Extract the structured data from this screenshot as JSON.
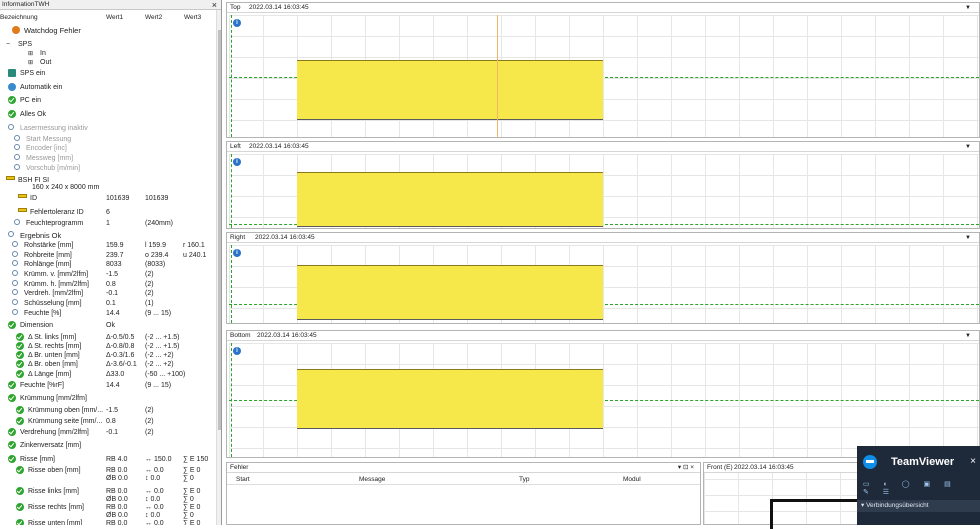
{
  "left_panel": {
    "title": "InformationTWH",
    "close": "×",
    "columns": [
      "Bezeichnung",
      "Wert1",
      "Wert2",
      "Wert3"
    ],
    "rows": [
      {
        "label": "Watchdog Fehler",
        "w1": "",
        "w2": "",
        "w3": ""
      },
      {
        "label": "SPS",
        "w1": "",
        "w2": "",
        "w3": ""
      },
      {
        "label": "In",
        "w1": "",
        "w2": "",
        "w3": ""
      },
      {
        "label": "Out",
        "w1": "",
        "w2": "",
        "w3": ""
      },
      {
        "label": "SPS ein",
        "w1": "",
        "w2": "",
        "w3": ""
      },
      {
        "label": "Automatik ein",
        "w1": "",
        "w2": "",
        "w3": ""
      },
      {
        "label": "PC ein",
        "w1": "",
        "w2": "",
        "w3": ""
      },
      {
        "label": "Alles Ok",
        "w1": "",
        "w2": "",
        "w3": ""
      },
      {
        "label": "Lasermessung inaktiv",
        "w1": "",
        "w2": "",
        "w3": ""
      },
      {
        "label": "Start Messung",
        "w1": "",
        "w2": "",
        "w3": ""
      },
      {
        "label": "Encoder [inc]",
        "w1": "",
        "w2": "",
        "w3": ""
      },
      {
        "label": "Messweg [mm]",
        "w1": "",
        "w2": "",
        "w3": ""
      },
      {
        "label": "Vorschub [m/min]",
        "w1": "",
        "w2": "",
        "w3": ""
      },
      {
        "label": "BSH   FI   SI",
        "w1": "",
        "w2": "",
        "w3": ""
      },
      {
        "label": "160 x 240 x 8000 mm",
        "w1": "",
        "w2": "",
        "w3": ""
      },
      {
        "label": "ID",
        "w1": "101639",
        "w2": "101639",
        "w3": ""
      },
      {
        "label": "Fehlertoleranz ID",
        "w1": "6",
        "w2": "",
        "w3": ""
      },
      {
        "label": "Feuchteprogramm",
        "w1": "1",
        "w2": "(240mm)",
        "w3": ""
      },
      {
        "label": "Ergebnis Ok",
        "w1": "",
        "w2": "",
        "w3": ""
      },
      {
        "label": "Rohstärke [mm]",
        "w1": "159.9",
        "w2": "l 159.9",
        "w3": "r 160.1"
      },
      {
        "label": "Rohbreite [mm]",
        "w1": "239.7",
        "w2": "o 239.4",
        "w3": "u 240.1"
      },
      {
        "label": "Rohlänge [mm]",
        "w1": "8033",
        "w2": "(8033)",
        "w3": ""
      },
      {
        "label": "Krümm. v. [mm/2lfm]",
        "w1": "-1.5",
        "w2": "(2)",
        "w3": ""
      },
      {
        "label": "Krümm. h. [mm/2lfm]",
        "w1": "0.8",
        "w2": "(2)",
        "w3": ""
      },
      {
        "label": "Verdreh. [mm/2lfm]",
        "w1": "-0.1",
        "w2": "(2)",
        "w3": ""
      },
      {
        "label": "Schüsselung [mm]",
        "w1": "0.1",
        "w2": "(1)",
        "w3": ""
      },
      {
        "label": "Feuchte [%]",
        "w1": "14.4",
        "w2": "(9 ... 15)",
        "w3": ""
      },
      {
        "label": "Dimension",
        "w1": "Ok",
        "w2": "",
        "w3": ""
      },
      {
        "label": "Δ St. links [mm]",
        "w1": "Δ-0.5/0.5",
        "w2": "(-2 ... +1.5)",
        "w3": ""
      },
      {
        "label": "Δ St. rechts [mm]",
        "w1": "Δ-0.8/0.8",
        "w2": "(-2 ... +1.5)",
        "w3": ""
      },
      {
        "label": "Δ Br. unten [mm]",
        "w1": "Δ-0.3/1.6",
        "w2": "(-2 ... +2)",
        "w3": ""
      },
      {
        "label": "Δ Br. oben [mm]",
        "w1": "Δ-3.6/-0.1",
        "w2": "(-2 ... +2)",
        "w3": ""
      },
      {
        "label": "Δ Länge [mm]",
        "w1": "Δ33.0",
        "w2": "(-50 ... +100)",
        "w3": ""
      },
      {
        "label": "Feuchte [%rF]",
        "w1": "14.4",
        "w2": "(9 ... 15)",
        "w3": ""
      },
      {
        "label": "Krümmung [mm/2lfm]",
        "w1": "",
        "w2": "",
        "w3": ""
      },
      {
        "label": "Krümmung oben [mm/...",
        "w1": "-1.5",
        "w2": "(2)",
        "w3": ""
      },
      {
        "label": "Krümmung seite [mm/...",
        "w1": "0.8",
        "w2": "(2)",
        "w3": ""
      },
      {
        "label": "Verdrehung [mm/2lfm]",
        "w1": "-0.1",
        "w2": "(2)",
        "w3": ""
      },
      {
        "label": "Zinkenversatz [mm]",
        "w1": "",
        "w2": "",
        "w3": ""
      },
      {
        "label": "Risse [mm]",
        "w1": "RB 4.0",
        "w2": "↔ 150.0",
        "w3": "∑ E 150"
      },
      {
        "label": "Risse oben [mm]",
        "w1": "RB 0.0",
        "w2": "↔ 0.0",
        "w3": "∑ E 0"
      },
      {
        "label": "",
        "w1": "ØB 0.0",
        "w2": "↕ 0.0",
        "w3": "∑ 0"
      },
      {
        "label": "Risse links [mm]",
        "w1": "RB 0.0",
        "w2": "↔ 0.0",
        "w3": "∑ E 0"
      },
      {
        "label": "",
        "w1": "ØB 0.0",
        "w2": "↕ 0.0",
        "w3": "∑ 0"
      },
      {
        "label": "Risse rechts [mm]",
        "w1": "RB 0.0",
        "w2": "↔ 0.0",
        "w3": "∑ E 0"
      },
      {
        "label": "",
        "w1": "ØB 0.0",
        "w2": "↕ 0.0",
        "w3": "∑ 0"
      },
      {
        "label": "Risse unten [mm]",
        "w1": "RB 0.0",
        "w2": "↔ 0.0",
        "w3": "∑ E 0"
      }
    ]
  },
  "panels": [
    {
      "name": "Top",
      "timestamp": "2022.03.14 16:03:45"
    },
    {
      "name": "Left",
      "timestamp": "2022.03.14 16:03:45"
    },
    {
      "name": "Right",
      "timestamp": "2022.03.14 16:03:45"
    },
    {
      "name": "Bottom",
      "timestamp": "2022.03.14 16:03:45"
    }
  ],
  "panel_arrow": "▼",
  "info_glyph": "i",
  "fehler": {
    "title": "Fehler",
    "controls": "▾ ⊡ ×",
    "columns": [
      "Start",
      "Message",
      "Typ",
      "Modul"
    ]
  },
  "front": {
    "name": "Front (E)",
    "timestamp": "2022.03.14 16:03:45"
  },
  "teamviewer": {
    "title": "TeamViewer",
    "close": "×",
    "icons": "▭ ◐ ◯ ▣ ▤ ✎ ☰",
    "section": "Verbindungsübersicht"
  },
  "colors": {
    "board": "#f6e84a",
    "dash": "#29a329",
    "teamviewer_bg": "#1e2a3a"
  }
}
